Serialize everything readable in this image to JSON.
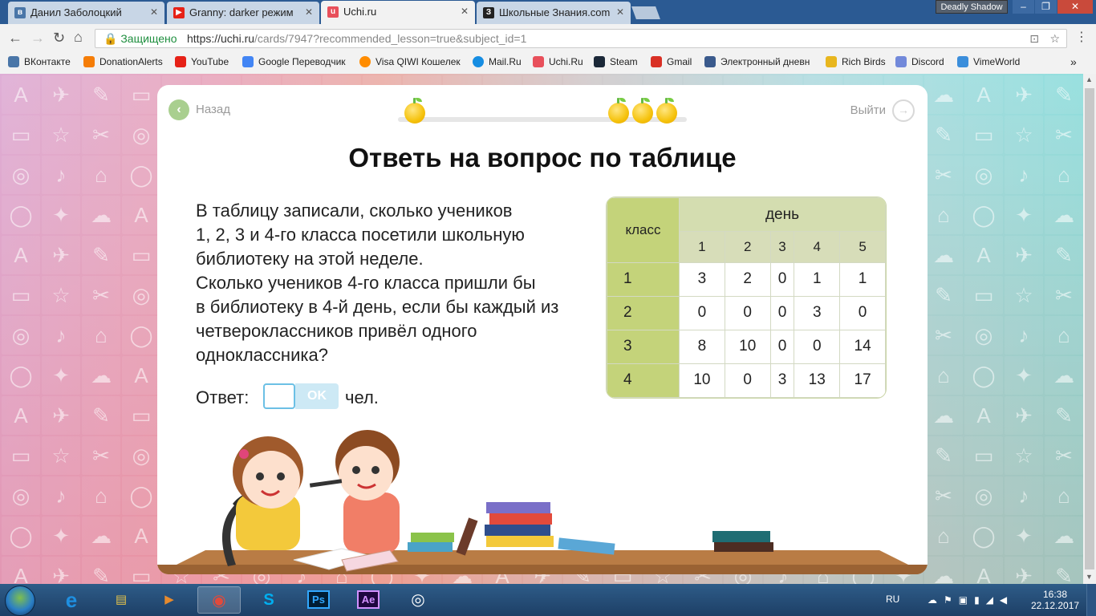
{
  "browser": {
    "tabs": [
      {
        "label": "Данил Заболоцкий",
        "icon": "vk-icon",
        "color": "#4a76a8",
        "glyph": "vk"
      },
      {
        "label": "Granny: darker режим",
        "icon": "youtube-icon",
        "color": "#e62117",
        "glyph": "▶"
      },
      {
        "label": "Uchi.ru",
        "icon": "uchi-icon",
        "color": "#e8505b",
        "glyph": "u"
      },
      {
        "label": "Школьные Знания.com",
        "icon": "znanija-icon",
        "color": "#222222",
        "glyph": "З"
      }
    ],
    "profile_name": "Deadly Shadow",
    "secure_label": "Защищено",
    "url_base": "https://uchi.ru",
    "url_path": "/cards/7947?recommended_lesson=true&subject_id=1",
    "bookmarks": [
      {
        "label": "ВКонтакте",
        "icon": "vk-icon",
        "color": "#4a76a8"
      },
      {
        "label": "DonationAlerts",
        "icon": "donationalerts-icon",
        "color": "#f57d07"
      },
      {
        "label": "YouTube",
        "icon": "youtube-icon",
        "color": "#e62117"
      },
      {
        "label": "Google Переводчик",
        "icon": "google-translate-icon",
        "color": "#4285f4"
      },
      {
        "label": "Visa QIWI Кошелек",
        "icon": "qiwi-icon",
        "color": "#ff8c00"
      },
      {
        "label": "Mail.Ru",
        "icon": "mailru-icon",
        "color": "#168de2"
      },
      {
        "label": "Uchi.Ru",
        "icon": "uchi-icon",
        "color": "#e8505b"
      },
      {
        "label": "Steam",
        "icon": "steam-icon",
        "color": "#1b2838"
      },
      {
        "label": "Gmail",
        "icon": "gmail-icon",
        "color": "#d93025"
      },
      {
        "label": "Электронный дневн",
        "icon": "diary-icon",
        "color": "#3a5a8c"
      },
      {
        "label": "Rich Birds",
        "icon": "richbirds-icon",
        "color": "#e8b61e"
      },
      {
        "label": "Discord",
        "icon": "discord-icon",
        "color": "#7289da"
      },
      {
        "label": "VimeWorld",
        "icon": "vimeworld-icon",
        "color": "#3b8edb"
      }
    ],
    "more_bookmarks": "»"
  },
  "lesson": {
    "back_label": "Назад",
    "exit_label": "Выйти",
    "title": "Ответь на вопрос по таблице",
    "question_lines": [
      "В таблицу записали, сколько учеников",
      "1, 2, 3 и 4-го класса посетили школьную",
      "библиотеку на этой неделе.",
      "Сколько учеников 4-го класса пришли бы",
      "в библиотеку в 4-й день, если бы каждый из",
      "четвероклассников привёл одного",
      "одноклассника?"
    ],
    "answer_label": "Ответ:",
    "answer_value": "",
    "ok_label": "OK",
    "unit_label": "чел.",
    "progress": {
      "apples_earned": 4,
      "total_steps": 6
    }
  },
  "table": {
    "class_header": "класс",
    "day_header": "день",
    "days": [
      "1",
      "2",
      "3",
      "4",
      "5"
    ],
    "rows": [
      {
        "class": "1",
        "values": [
          "3",
          "2",
          "0",
          "1",
          "1"
        ]
      },
      {
        "class": "2",
        "values": [
          "0",
          "0",
          "0",
          "3",
          "0"
        ]
      },
      {
        "class": "3",
        "values": [
          "8",
          "10",
          "0",
          "0",
          "14"
        ]
      },
      {
        "class": "4",
        "values": [
          "10",
          "0",
          "3",
          "13",
          "17"
        ]
      }
    ]
  },
  "taskbar": {
    "apps": [
      {
        "name": "internet-explorer-icon",
        "glyph": "e",
        "color": "#1e8fe1"
      },
      {
        "name": "file-explorer-icon",
        "glyph": "▤",
        "color": "#e6c34a"
      },
      {
        "name": "media-player-icon",
        "glyph": "▶",
        "color": "#e68a2e"
      },
      {
        "name": "chrome-icon",
        "glyph": "◉",
        "color": "#db4437"
      },
      {
        "name": "skype-icon",
        "glyph": "S",
        "color": "#00aff0"
      },
      {
        "name": "photoshop-icon",
        "glyph": "Ps",
        "color": "#001d34"
      },
      {
        "name": "after-effects-icon",
        "glyph": "Ae",
        "color": "#1f0740"
      },
      {
        "name": "steam-icon",
        "glyph": "◎",
        "color": "#1b2838"
      }
    ],
    "lang": "RU",
    "time": "16:38",
    "date": "22.12.2017"
  }
}
